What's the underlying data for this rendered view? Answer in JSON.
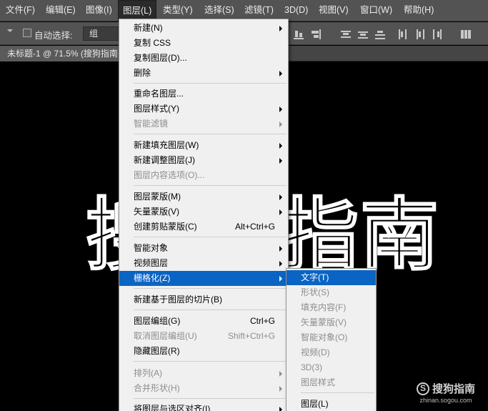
{
  "menubar": {
    "items": [
      "文件(F)",
      "编辑(E)",
      "图像(I)",
      "图层(L)",
      "类型(Y)",
      "选择(S)",
      "滤镜(T)",
      "3D(D)",
      "视图(V)",
      "窗口(W)",
      "帮助(H)"
    ],
    "active_index": 3
  },
  "options_bar": {
    "auto_select_label": "自动选择:",
    "auto_select_checked": false,
    "target_value": "组"
  },
  "document_tab": {
    "title": "未标题-1 @ 71.5% (搜狗指南"
  },
  "canvas": {
    "background": "#000000",
    "text_left": "搜",
    "text_right": "指南"
  },
  "layer_menu": {
    "items": [
      {
        "label": "新建(N)",
        "shortcut": "",
        "submenu": true,
        "disabled": false
      },
      {
        "label": "复制 CSS",
        "shortcut": "",
        "submenu": false,
        "disabled": false
      },
      {
        "label": "复制图层(D)...",
        "shortcut": "",
        "submenu": false,
        "disabled": false
      },
      {
        "label": "删除",
        "shortcut": "",
        "submenu": true,
        "disabled": false
      },
      {
        "label": "重命名图层...",
        "shortcut": "",
        "submenu": false,
        "disabled": false
      },
      {
        "label": "图层样式(Y)",
        "shortcut": "",
        "submenu": true,
        "disabled": false
      },
      {
        "label": "智能滤镜",
        "shortcut": "",
        "submenu": true,
        "disabled": true
      },
      {
        "label": "新建填充图层(W)",
        "shortcut": "",
        "submenu": true,
        "disabled": false
      },
      {
        "label": "新建调整图层(J)",
        "shortcut": "",
        "submenu": true,
        "disabled": false
      },
      {
        "label": "图层内容选项(O)...",
        "shortcut": "",
        "submenu": false,
        "disabled": true
      },
      {
        "label": "图层蒙版(M)",
        "shortcut": "",
        "submenu": true,
        "disabled": false
      },
      {
        "label": "矢量蒙版(V)",
        "shortcut": "",
        "submenu": true,
        "disabled": false
      },
      {
        "label": "创建剪贴蒙版(C)",
        "shortcut": "Alt+Ctrl+G",
        "submenu": false,
        "disabled": false
      },
      {
        "label": "智能对象",
        "shortcut": "",
        "submenu": true,
        "disabled": false
      },
      {
        "label": "视频图层",
        "shortcut": "",
        "submenu": true,
        "disabled": false
      },
      {
        "label": "栅格化(Z)",
        "shortcut": "",
        "submenu": true,
        "disabled": false,
        "highlighted": true
      },
      {
        "label": "新建基于图层的切片(B)",
        "shortcut": "",
        "submenu": false,
        "disabled": false
      },
      {
        "label": "图层编组(G)",
        "shortcut": "Ctrl+G",
        "submenu": false,
        "disabled": false
      },
      {
        "label": "取消图层编组(U)",
        "shortcut": "Shift+Ctrl+G",
        "submenu": false,
        "disabled": true
      },
      {
        "label": "隐藏图层(R)",
        "shortcut": "",
        "submenu": false,
        "disabled": false
      },
      {
        "label": "排列(A)",
        "shortcut": "",
        "submenu": true,
        "disabled": true
      },
      {
        "label": "合并形状(H)",
        "shortcut": "",
        "submenu": true,
        "disabled": true
      },
      {
        "label": "将图层与选区对齐(I)",
        "shortcut": "",
        "submenu": true,
        "disabled": false
      }
    ]
  },
  "rasterize_submenu": {
    "items": [
      {
        "label": "文字(T)",
        "disabled": false,
        "highlighted": true
      },
      {
        "label": "形状(S)",
        "disabled": true
      },
      {
        "label": "填充内容(F)",
        "disabled": true
      },
      {
        "label": "矢量蒙版(V)",
        "disabled": true
      },
      {
        "label": "智能对象(O)",
        "disabled": true
      },
      {
        "label": "视频(D)",
        "disabled": true
      },
      {
        "label": "3D(3)",
        "disabled": true
      },
      {
        "label": "图层样式",
        "disabled": true
      },
      {
        "label": "图层(L)",
        "disabled": false
      }
    ]
  },
  "watermark": {
    "brand": "搜狗指南",
    "url": "zhinan.sogou.com"
  },
  "colors": {
    "menubar_bg": "#535353",
    "menu_bg": "#f0f0f0",
    "highlight": "#0a64c4",
    "disabled_text": "#8d8d8d"
  }
}
